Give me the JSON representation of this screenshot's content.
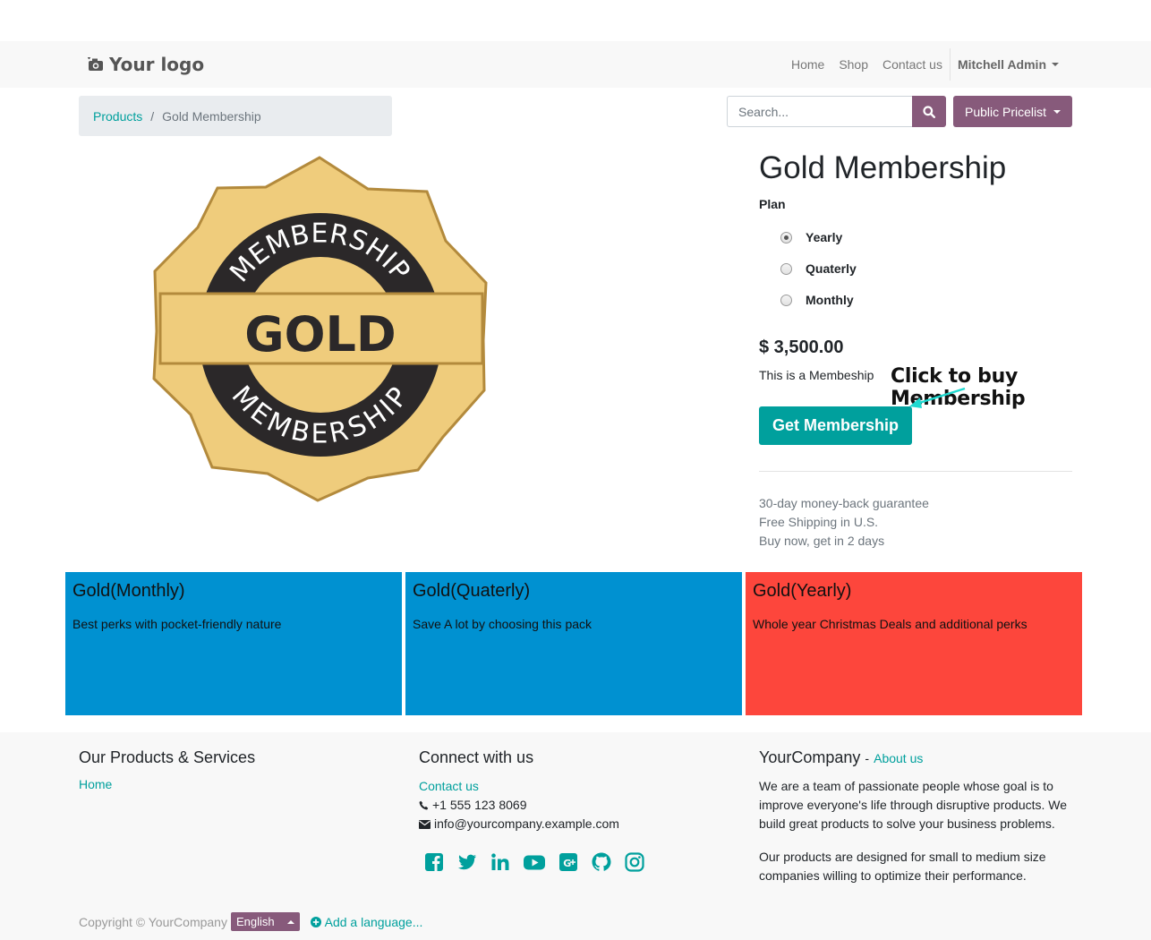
{
  "navbar": {
    "logo_text": "Your logo",
    "links": [
      "Home",
      "Shop",
      "Contact us"
    ],
    "user": "Mitchell Admin"
  },
  "breadcrumb": {
    "parent": "Products",
    "separator": "/",
    "current": "Gold Membership"
  },
  "search": {
    "placeholder": "Search..."
  },
  "pricelist": {
    "label": "Public Pricelist"
  },
  "badge": {
    "top_text": "MEMBERSHIP",
    "center_text": "GOLD",
    "bottom_text": "MEMBERSHIP"
  },
  "product": {
    "title": "Gold Membership",
    "plan_label": "Plan",
    "plans": [
      {
        "label": "Yearly",
        "checked": true
      },
      {
        "label": "Quaterly",
        "checked": false
      },
      {
        "label": "Monthly",
        "checked": false
      }
    ],
    "price": "$ 3,500.00",
    "description": "This is a Membeship",
    "buy_label": "Get Membership",
    "annotation": "Click to buy Membership",
    "perks": [
      "30-day money-back guarantee",
      "Free Shipping in U.S.",
      "Buy now, get in 2 days"
    ]
  },
  "cards": [
    {
      "title": "Gold(Monthly)",
      "text": "Best perks with pocket-friendly nature",
      "color": "#0091d1"
    },
    {
      "title": "Gold(Quaterly)",
      "text": "Save A lot by choosing this pack",
      "color": "#0091d1"
    },
    {
      "title": "Gold(Yearly)",
      "text": "Whole year Christmas Deals and additional perks",
      "color": "#fd463c"
    }
  ],
  "footer": {
    "col1": {
      "heading": "Our Products & Services",
      "link": "Home"
    },
    "col2": {
      "heading": "Connect with us",
      "contact": "Contact us",
      "phone": "+1 555 123 8069",
      "email": "info@yourcompany.example.com",
      "social_icons": [
        "facebook-icon",
        "twitter-icon",
        "linkedin-icon",
        "youtube-icon",
        "google-plus-icon",
        "github-icon",
        "instagram-icon"
      ]
    },
    "col3": {
      "heading": "YourCompany",
      "dash": "-",
      "about": "About us",
      "p1": "We are a team of passionate people whose goal is to improve everyone's life through disruptive products. We build great products to solve your business problems.",
      "p2": "Our products are designed for small to medium size companies willing to optimize their performance."
    },
    "copyright": "Copyright © YourCompany",
    "language": "English",
    "add_language": "Add a language..."
  },
  "colors": {
    "primary": "#00a09d",
    "secondary": "#875a7b",
    "gold": "#efcc7c"
  }
}
